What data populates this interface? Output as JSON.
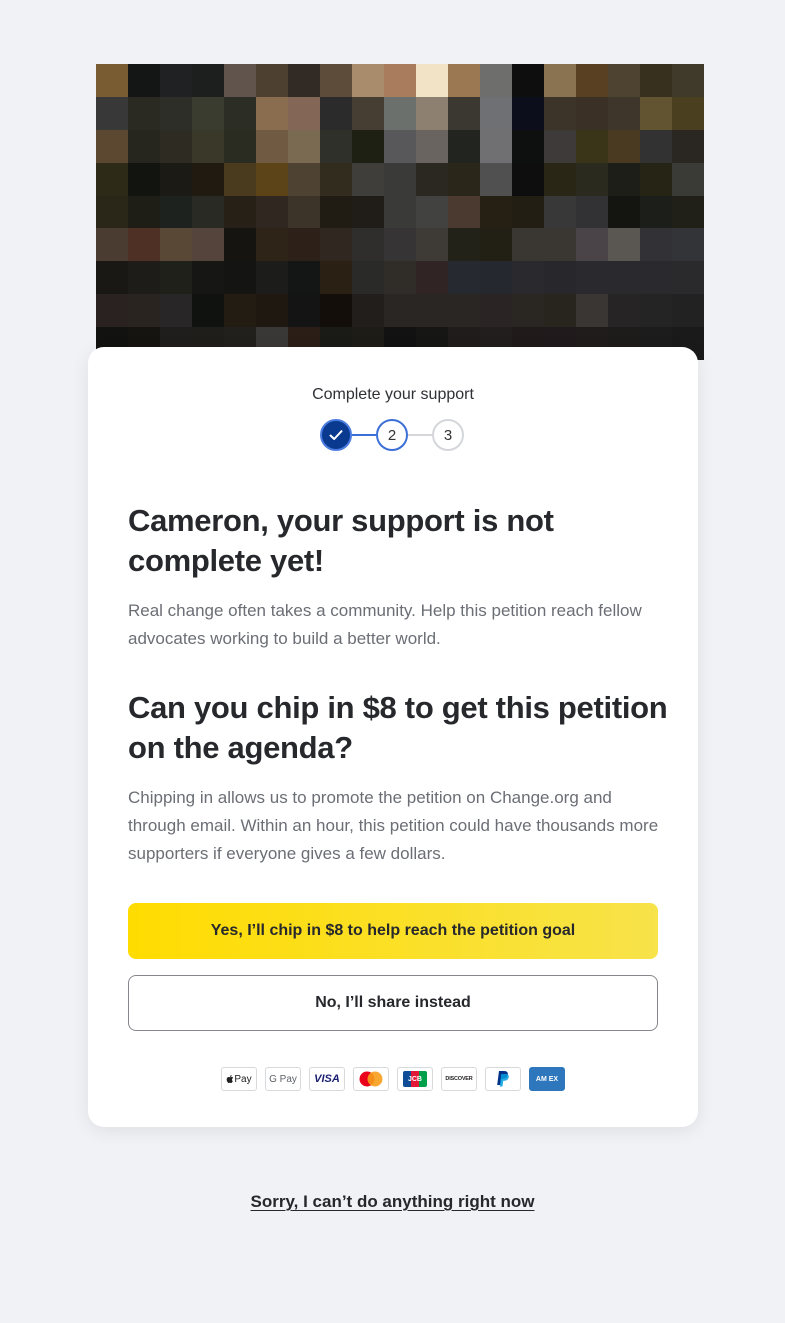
{
  "hero": {
    "pixel_colors": [
      "#7a5c33",
      "#141616",
      "#1f2122",
      "#1d1f1f",
      "#60544c",
      "#4d4030",
      "#322a25",
      "#5e4c3b",
      "#a88c6c",
      "#a87c5c",
      "#f2e2c6",
      "#9c7852",
      "#6e6e6c",
      "#0e0e0f",
      "#8a7350",
      "#5a4022",
      "#4e4230",
      "#38301f",
      "#3f3a2a",
      "#383838",
      "#2a2a22",
      "#2e2e28",
      "#3a3c30",
      "#2c2e26",
      "#8a6c4e",
      "#846656",
      "#2b2b2b",
      "#463e32",
      "#6c706c",
      "#8e8070",
      "#3a3830",
      "#6e7074",
      "#0c0e1c",
      "#3c3428",
      "#3a3026",
      "#3e362a",
      "#625430",
      "#4a4020",
      "#5c4830",
      "#26261e",
      "#2e2c22",
      "#3a3828",
      "#2a2c22",
      "#705a42",
      "#7a6a52",
      "#30302a",
      "#1e2014",
      "#58585a",
      "#6a6460",
      "#222420",
      "#707072",
      "#0e1010",
      "#3e3a3a",
      "#3a3418",
      "#4a3a22",
      "#323232",
      "#2a2622",
      "#2e2a18",
      "#121410",
      "#1c1a14",
      "#201a10",
      "#4a3a1e",
      "#5c4418",
      "#4e4232",
      "#322c1e",
      "#403e3a",
      "#3a3a38",
      "#2a2820",
      "#2a261a",
      "#505050",
      "#0e0e0e",
      "#2a2616",
      "#2a2a1e",
      "#1e1e18",
      "#262414",
      "#3a3a36",
      "#2a2618",
      "#1e1e16",
      "#1e221e",
      "#2a2a24",
      "#262016",
      "#302820",
      "#3c3428",
      "#201c14",
      "#201c18",
      "#3a3a38",
      "#424240",
      "#4a3a30",
      "#262014",
      "#221e14",
      "#383838",
      "#323234",
      "#141410",
      "#1c1e1a",
      "#202018",
      "#4a3c30",
      "#4e3024",
      "#5a4836",
      "#54443c",
      "#161410",
      "#2e2418",
      "#2c2018",
      "#302820",
      "#302e2c",
      "#363434",
      "#3e3a36",
      "#222218",
      "#222014",
      "#3a3632",
      "#3a3632",
      "#4a4448",
      "#5a5652",
      "#323236",
      "#323438",
      "#1a1814",
      "#1e1c18",
      "#20201a",
      "#161614",
      "#141412",
      "#1c1c1a",
      "#141616",
      "#2a2014",
      "#2a2a28",
      "#302c28",
      "#302424",
      "#262a30",
      "#262830",
      "#2a2a2e",
      "#28282c",
      "#2a2a2e",
      "#2a2a2e",
      "#2a2a2e",
      "#2a2a2c",
      "#2a2220",
      "#2a2420",
      "#282626",
      "#101210",
      "#221c12",
      "#1e1810",
      "#141414",
      "#140e0a",
      "#221e1c",
      "#2a2624",
      "#2a2624",
      "#2a2624",
      "#2a2424",
      "#2a2622",
      "#28241e",
      "#3a3634",
      "#262424",
      "#242424",
      "#222222",
      "#121210",
      "#161410",
      "#201e1c",
      "#201e1a",
      "#22201c",
      "#3a3836",
      "#2a1e16",
      "#1a1a16",
      "#1e1c16",
      "#121212",
      "#161614",
      "#201c1c",
      "#221e1e",
      "#201a1a",
      "#201a1c",
      "#201c1c",
      "#1e1c1a",
      "#1c1c1c",
      "#1a1a1a"
    ]
  },
  "steps": {
    "label": "Complete your support",
    "step2": "2",
    "step3": "3"
  },
  "main": {
    "heading1": "Cameron, your support is not complete yet!",
    "paragraph1": "Real change often takes a community. Help this petition reach fellow advocates working to build a better world.",
    "heading2": "Can you chip in $8 to get this petition on the agenda?",
    "paragraph2": "Chipping in allows us to promote the petition on Change.org and through email. Within an hour, this petition could have thousands more supporters if everyone gives a few dollars."
  },
  "buttons": {
    "primary": "Yes, I’ll chip in $8 to help reach the petition goal",
    "secondary": "No, I’ll share instead"
  },
  "payments": {
    "apple_pay": "Pay",
    "google_pay": "G Pay",
    "visa": "VISA",
    "jcb": "JCB",
    "discover": "DISCOVER",
    "amex": "AM EX",
    "colors": {
      "visa": "#1a1f71",
      "mastercard_red": "#eb001b",
      "mastercard_orange": "#f79e1b",
      "paypal_dark": "#003087",
      "paypal_light": "#009cde",
      "amex": "#2e77bc",
      "discover_orange": "#f48120"
    }
  },
  "footer": {
    "decline_link": "Sorry, I can’t do anything right now"
  },
  "colors": {
    "background": "#f1f2f6",
    "primary_button": "#ffdc00",
    "step_active": "#0a3a8f",
    "step_current_border": "#3b6fd6",
    "heading": "#26282c",
    "body_text": "#6b6e75"
  }
}
